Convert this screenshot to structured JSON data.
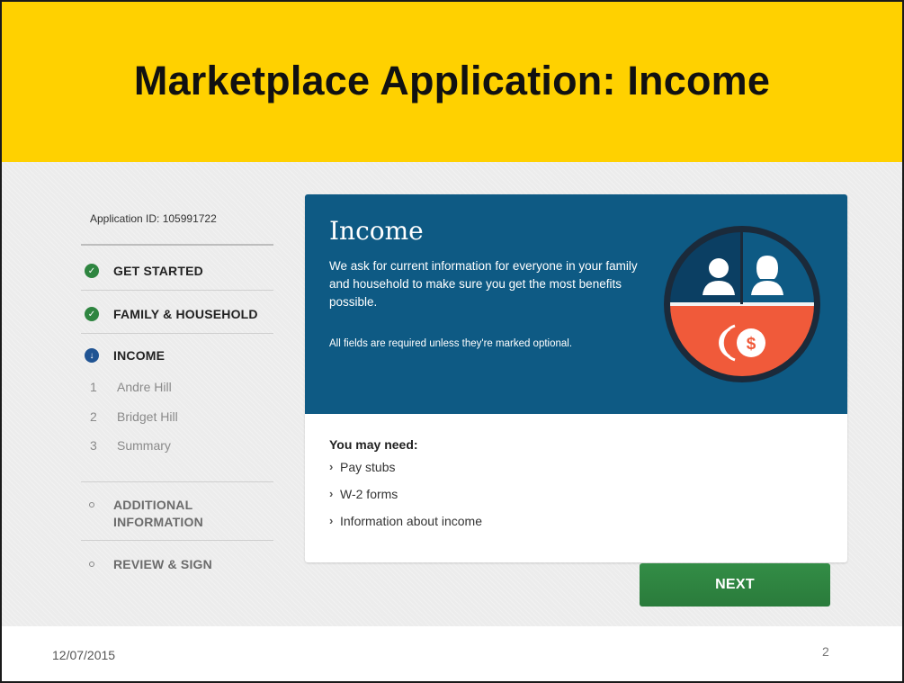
{
  "slide": {
    "title": "Marketplace Application: Income",
    "date": "12/07/2015",
    "page_number": "2"
  },
  "sidebar": {
    "application_id": "Application ID: 105991722",
    "steps": [
      {
        "label": "GET STARTED",
        "status": "done"
      },
      {
        "label": "FAMILY & HOUSEHOLD",
        "status": "done"
      },
      {
        "label": "INCOME",
        "status": "current"
      },
      {
        "label": "ADDITIONAL INFORMATION",
        "status": "todo"
      },
      {
        "label": "REVIEW & SIGN",
        "status": "todo"
      }
    ],
    "income_substeps": [
      {
        "num": "1",
        "label": "Andre Hill"
      },
      {
        "num": "2",
        "label": "Bridget Hill"
      },
      {
        "num": "3",
        "label": "Summary"
      }
    ],
    "icons": {
      "done": "check-circle-icon",
      "current": "arrow-down-circle-icon",
      "todo": "hollow-circle-icon"
    }
  },
  "card": {
    "title": "Income",
    "description": "We ask for current information for everyone in your family and household to make sure you get the most benefits possible.",
    "note": "All fields are required unless they're marked optional.",
    "illustration_icon": "people-and-money-icon",
    "need_title": "You may need:",
    "need_items": [
      "Pay stubs",
      "W-2 forms",
      "Information about income"
    ]
  },
  "actions": {
    "next_label": "NEXT"
  },
  "colors": {
    "banner": "#ffd100",
    "card_header": "#0e5a84",
    "done": "#2e8540",
    "current": "#205493",
    "money": "#f05a3a",
    "button": "#2e8540"
  }
}
